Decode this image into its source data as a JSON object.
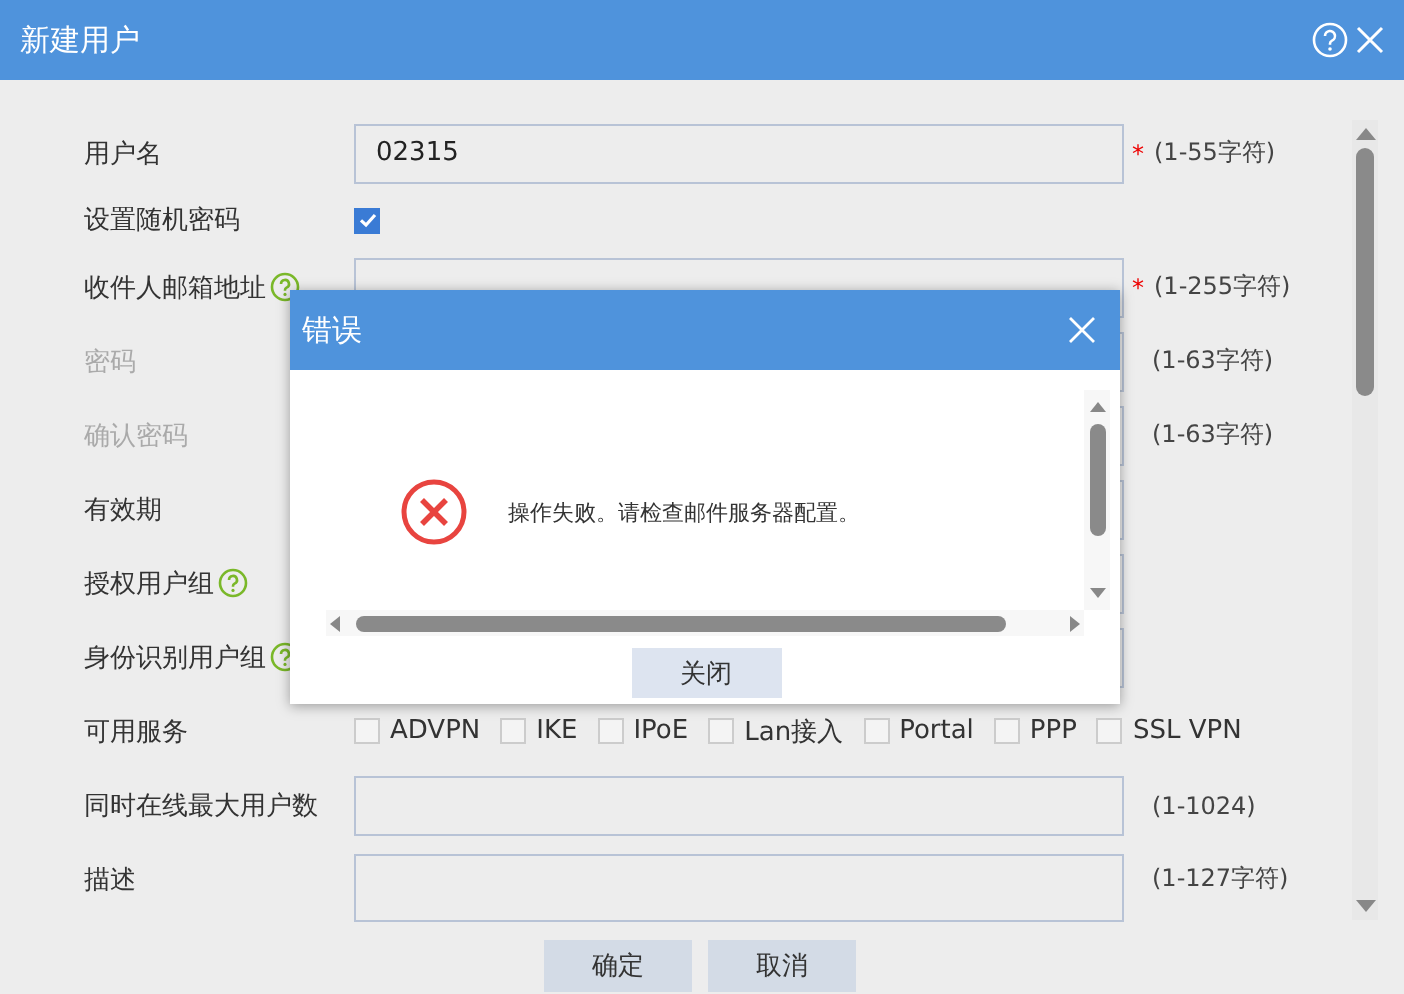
{
  "window": {
    "title": "新建用户"
  },
  "form": [
    {
      "kind": "text",
      "label": "用户名",
      "value": "02315",
      "required_mark": "*",
      "hint": "(1-55字符)",
      "disabled": false,
      "help": false
    },
    {
      "kind": "checkbox",
      "label": "设置随机密码",
      "checked": true,
      "disabled": false,
      "help": false
    },
    {
      "kind": "text",
      "label": "收件人邮箱地址",
      "required_mark": "*",
      "hint": "(1-255字符)",
      "disabled": false,
      "help": true
    },
    {
      "kind": "text",
      "label": "密码",
      "hint": "(1-63字符)",
      "disabled": true,
      "help": false
    },
    {
      "kind": "text",
      "label": "确认密码",
      "hint": "(1-63字符)",
      "disabled": true,
      "help": false
    },
    {
      "kind": "text",
      "label": "有效期",
      "disabled": false,
      "help": false
    },
    {
      "kind": "text",
      "label": "授权用户组",
      "disabled": false,
      "help": true
    },
    {
      "kind": "text",
      "label": "身份识别用户组",
      "disabled": false,
      "help": true
    },
    {
      "kind": "services",
      "label": "可用服务",
      "disabled": false,
      "help": false,
      "options": [
        {
          "label": "ADVPN",
          "checked": false
        },
        {
          "label": "IKE",
          "checked": false
        },
        {
          "label": "IPoE",
          "checked": false
        },
        {
          "label": "Lan接入",
          "checked": false
        },
        {
          "label": "Portal",
          "checked": false
        },
        {
          "label": "PPP",
          "checked": false
        },
        {
          "label": "SSL VPN",
          "checked": false
        }
      ]
    },
    {
      "kind": "text",
      "label": "同时在线最大用户数",
      "hint": "(1-1024)",
      "disabled": false,
      "help": false
    },
    {
      "kind": "textarea",
      "label": "描述",
      "hint": "(1-127字符)",
      "disabled": false,
      "help": false
    }
  ],
  "buttons": [
    "确定",
    "取消"
  ],
  "dialog": {
    "title": "错误",
    "message": "操作失败。请检查邮件服务器配置。",
    "button": "关闭"
  }
}
